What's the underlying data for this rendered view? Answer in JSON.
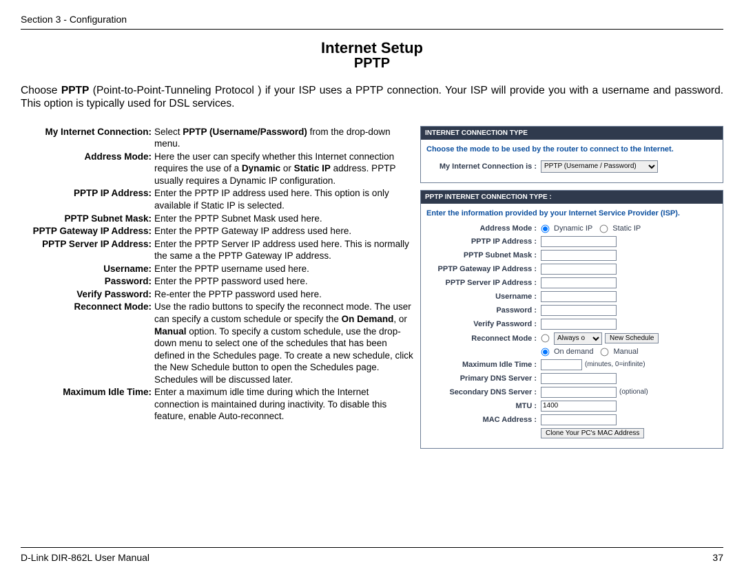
{
  "header": {
    "section": "Section 3 - Configuration"
  },
  "title": {
    "main": "Internet Setup",
    "sub": "PPTP"
  },
  "intro": {
    "pre": "Choose ",
    "bold1": "PPTP",
    "post": " (Point-to-Point-Tunneling Protocol ) if your ISP uses a PPTP connection. Your ISP will provide you with a username and password. This option is typically used for DSL services."
  },
  "definitions": [
    {
      "label": "My Internet Connection:",
      "html": "Select <b>PPTP (Username/Password)</b> from the drop-down menu."
    },
    {
      "label": "Address Mode:",
      "html": "Here the user can specify whether this Internet connection requires the use of a <b>Dynamic</b> or <b>Static IP</b> address. PPTP usually requires a Dynamic IP configuration."
    },
    {
      "label": "PPTP IP Address:",
      "html": "Enter the PPTP IP address used here. This option is only available if Static IP is selected."
    },
    {
      "label": "PPTP Subnet Mask:",
      "html": "Enter the PPTP Subnet Mask used here."
    },
    {
      "label": "PPTP Gateway IP Address:",
      "html": "Enter the PPTP Gateway IP address used here."
    },
    {
      "label": "PPTP Server IP Address:",
      "html": "Enter the PPTP Server IP address used here. This is normally the same a the PPTP Gateway IP address."
    },
    {
      "label": "Username:",
      "html": "Enter the PPTP username used here."
    },
    {
      "label": "Password:",
      "html": "Enter the PPTP password used here."
    },
    {
      "label": "Verify Password:",
      "html": "Re-enter the PPTP password used here."
    },
    {
      "label": "Reconnect Mode:",
      "html": "Use the radio buttons to specify the reconnect mode. The user can specify a custom schedule or specify the <b>On Demand</b>, or <b>Manual</b> option. To specify a custom schedule, use the drop-down menu to select one of the schedules that has been defined in the Schedules page. To create a new schedule, click the New Schedule button to open the Schedules page. Schedules will be discussed later."
    },
    {
      "label": "Maximum Idle Time:",
      "html": "Enter a maximum idle time during which the Internet connection is maintained during inactivity. To disable this feature, enable Auto-reconnect."
    }
  ],
  "panel_top": {
    "title": "INTERNET CONNECTION TYPE",
    "desc": "Choose the mode to be used by the router to connect to the Internet.",
    "field_label": "My Internet Connection is :",
    "selected": "PPTP (Username / Password)"
  },
  "panel_pptp": {
    "title": "PPTP INTERNET CONNECTION TYPE :",
    "desc": "Enter the information provided by your Internet Service Provider (ISP).",
    "labels": {
      "address_mode": "Address Mode :",
      "dyn": "Dynamic IP",
      "sta": "Static IP",
      "pptp_ip": "PPTP IP Address :",
      "subnet": "PPTP Subnet Mask :",
      "gateway": "PPTP Gateway IP Address :",
      "server": "PPTP Server IP Address :",
      "username": "Username :",
      "password": "Password :",
      "verify": "Verify Password :",
      "reconnect": "Reconnect Mode :",
      "always": "Always o",
      "new_sched": "New Schedule",
      "on_demand": "On demand",
      "manual": "Manual",
      "max_idle": "Maximum Idle Time :",
      "idle_note": "(minutes, 0=infinite)",
      "primary_dns": "Primary DNS Server :",
      "secondary_dns": "Secondary DNS Server :",
      "optional": "(optional)",
      "mtu": "MTU :",
      "mtu_value": "1400",
      "mac": "MAC Address :",
      "clone": "Clone Your PC's MAC Address"
    }
  },
  "footer": {
    "left": "D-Link DIR-862L User Manual",
    "right": "37"
  }
}
